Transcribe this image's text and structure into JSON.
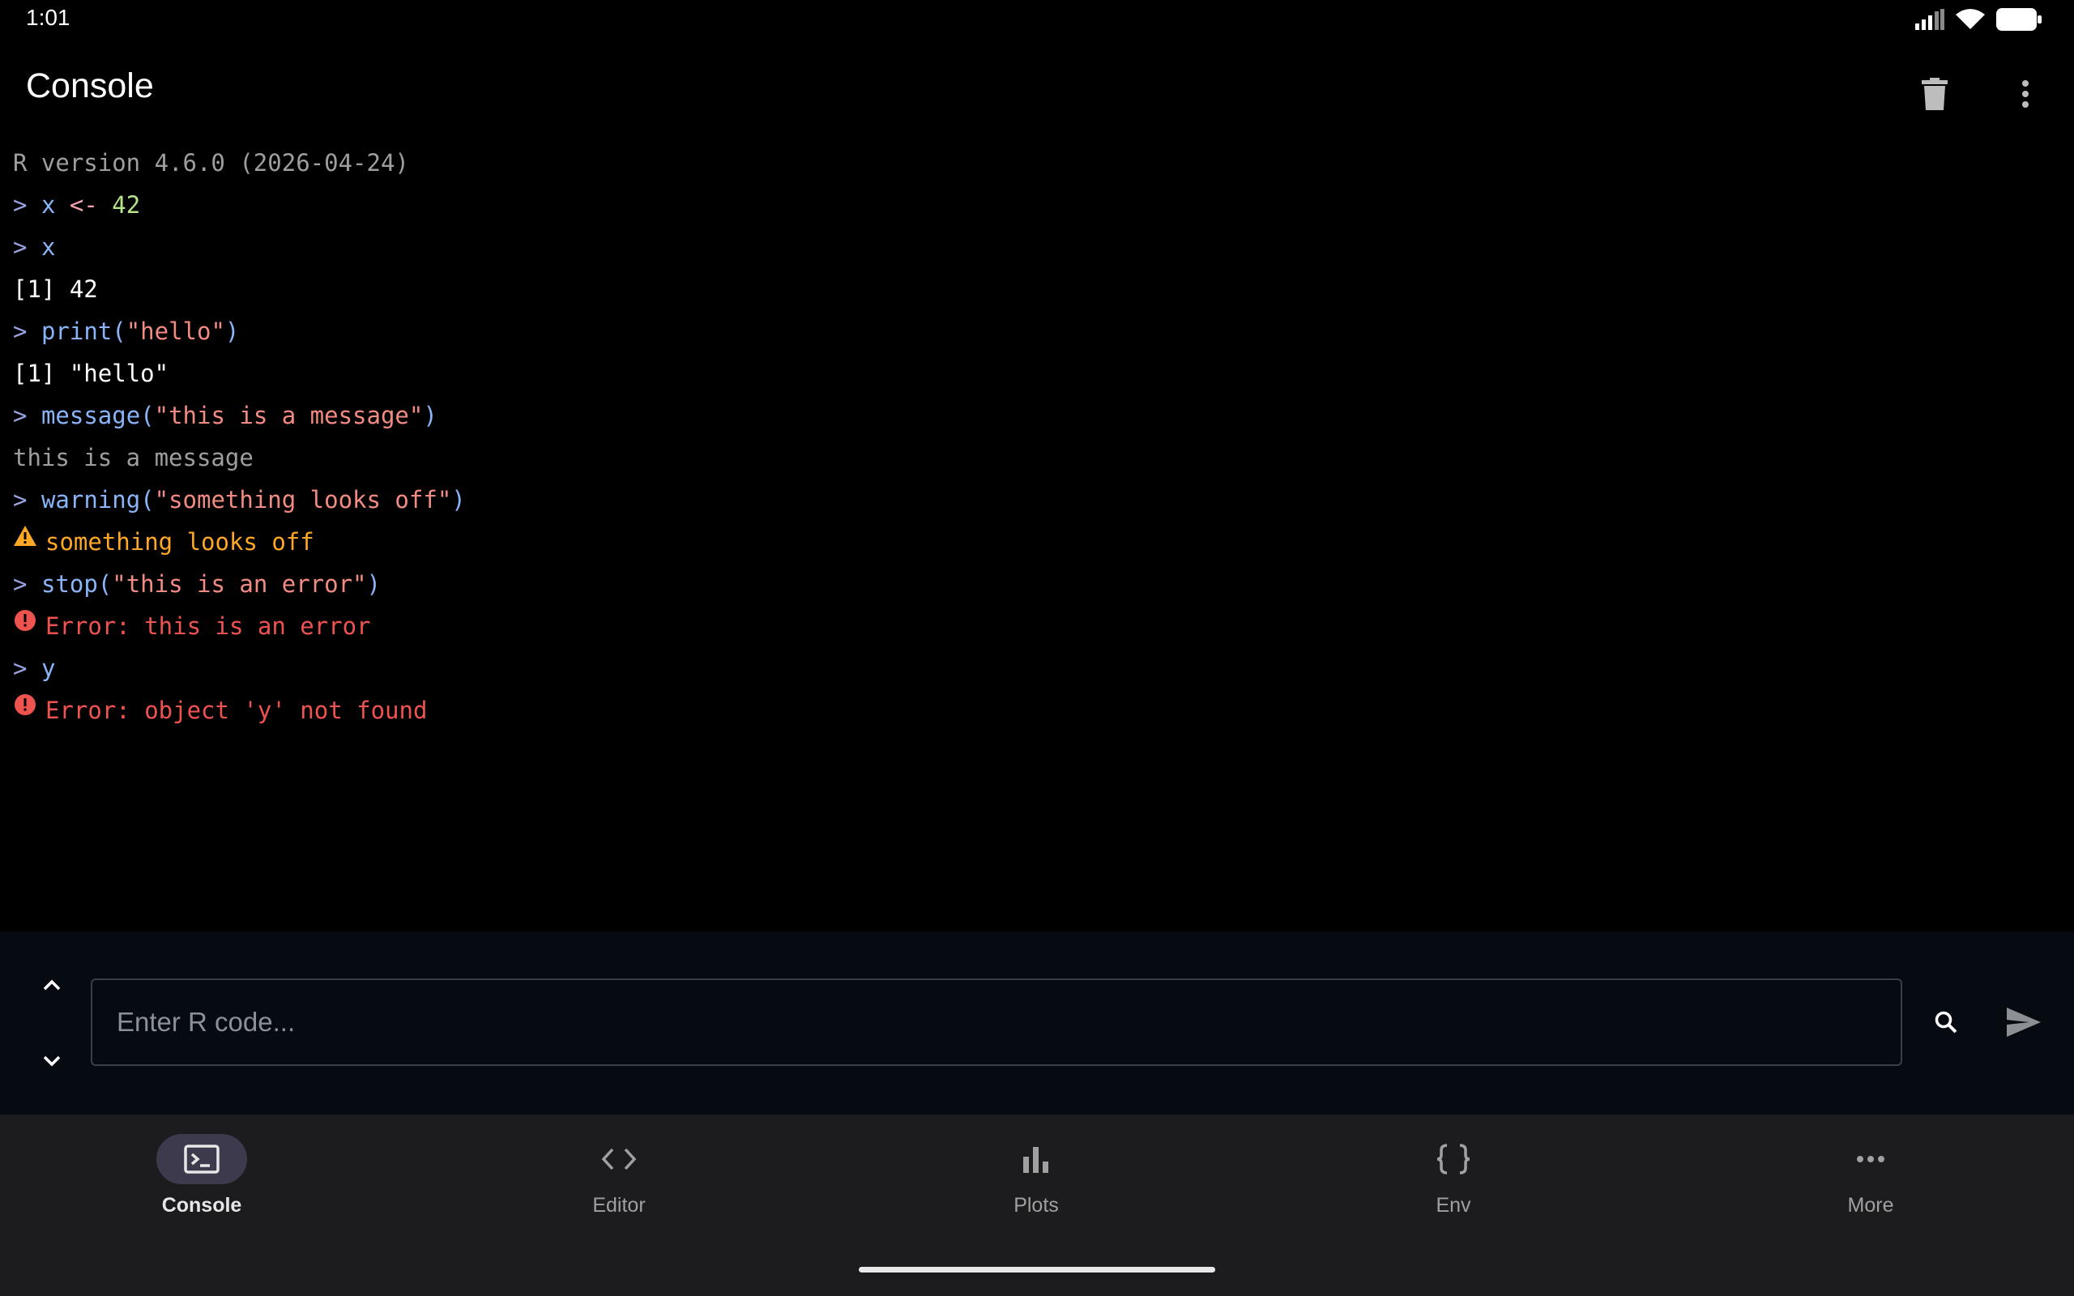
{
  "status_bar": {
    "time": "1:01"
  },
  "app_bar": {
    "title": "Console",
    "icons": [
      "trash-icon",
      "more-vert-icon"
    ]
  },
  "console": {
    "version_line": "R version 4.6.0 (2026-04-24)",
    "prompt": ">",
    "lines": {
      "assign": {
        "var": "x",
        "op": "<-",
        "num": "42"
      },
      "eval_x": {
        "code": "x"
      },
      "out_42": {
        "text": "[1] 42"
      },
      "print_call": {
        "fn": "print(",
        "arg": "\"hello\"",
        "close": ")"
      },
      "out_hello": {
        "text": "[1] \"hello\""
      },
      "message_call": {
        "fn": "message(",
        "arg": "\"this is a message\"",
        "close": ")"
      },
      "message_out": {
        "text": "this is a message"
      },
      "warning_call": {
        "fn": "warning(",
        "arg": "\"something looks off\"",
        "close": ")"
      },
      "warning_out": {
        "text": "something looks off"
      },
      "stop_call": {
        "fn": "stop(",
        "arg": "\"this is an error\"",
        "close": ")"
      },
      "error_out_1": {
        "text": "Error: this is an error"
      },
      "eval_y": {
        "code": "y"
      },
      "error_out_2": {
        "text": "Error: object 'y' not found"
      }
    }
  },
  "input": {
    "placeholder": "Enter R code...",
    "value": ""
  },
  "nav": {
    "items": [
      {
        "label": "Console",
        "icon": "terminal-icon",
        "active": true
      },
      {
        "label": "Editor",
        "icon": "code-icon",
        "active": false
      },
      {
        "label": "Plots",
        "icon": "bar-chart-icon",
        "active": false
      },
      {
        "label": "Env",
        "icon": "braces-icon",
        "active": false
      },
      {
        "label": "More",
        "icon": "more-horiz-icon",
        "active": false
      }
    ]
  },
  "colors": {
    "background": "#000000",
    "input_panel": "#060b12",
    "nav_bar": "#1c1c1e",
    "code": "#8ab4f8",
    "string": "#f28b82",
    "warning": "#ffa726",
    "error": "#ef5350",
    "active_pill": "#3e3a4e"
  }
}
